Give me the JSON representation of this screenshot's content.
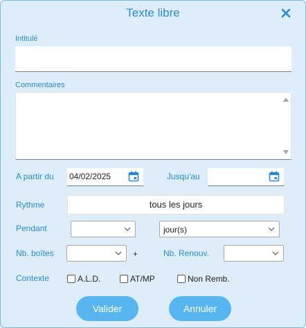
{
  "dialog": {
    "title": "Texte libre",
    "close_icon": "close-icon"
  },
  "fields": {
    "intitule_label": "Intitulé",
    "intitule_value": "",
    "commentaires_label": "Commentaires",
    "commentaires_value": "",
    "a_partir_du_label": "A partir du",
    "a_partir_du_value": "04/02/2025",
    "jusqu_au_label": "Jusqu'au",
    "jusqu_au_value": "",
    "rythme_label": "Rythme",
    "rythme_value": "tous les jours",
    "pendant_label": "Pendant",
    "pendant_value": "",
    "pendant_unit_value": "jour(s)",
    "nb_boites_label": "Nb. boîtes",
    "nb_boites_value": "",
    "plus_sign": "+",
    "nb_renouv_label": "Nb. Renouv.",
    "nb_renouv_value": "",
    "contexte_label": "Contexte"
  },
  "checkboxes": [
    {
      "label": "A.L.D.",
      "checked": false
    },
    {
      "label": "AT/MP",
      "checked": false
    },
    {
      "label": "Non Remb.",
      "checked": false
    }
  ],
  "buttons": {
    "valider": "Valider",
    "annuler": "Annuler"
  },
  "colors": {
    "accent": "#2a8ad9",
    "button": "#57b6f0",
    "background": "#ddeefa"
  }
}
